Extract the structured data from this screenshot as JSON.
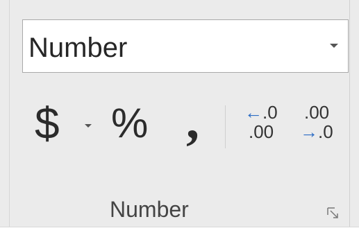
{
  "number_format": {
    "selected": "Number"
  },
  "buttons": {
    "currency_symbol": "$",
    "percent_symbol": "%",
    "comma_symbol": ",",
    "increase_decimal": {
      "top": ".0",
      "bottom": ".00"
    },
    "decrease_decimal": {
      "top": ".00",
      "bottom": ".0"
    }
  },
  "group": {
    "label": "Number"
  },
  "icons": {
    "dropdown_arrow": "chevron-down-icon",
    "currency": "dollar-icon",
    "percent": "percent-icon",
    "comma": "comma-style-icon",
    "increase_decimal": "increase-decimal-icon",
    "decrease_decimal": "decrease-decimal-icon",
    "launcher": "dialog-launcher-icon"
  },
  "colors": {
    "panel_background": "#ebebeb",
    "arrow_accent": "#2b6cc4",
    "text": "#262626"
  }
}
